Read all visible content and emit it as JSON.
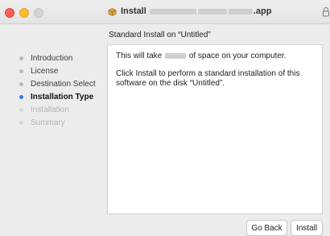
{
  "window": {
    "title_prefix": "Install",
    "title_suffix": ".app",
    "subtitle": "Standard Install on “Untitled”"
  },
  "sidebar": {
    "steps": [
      {
        "label": "Introduction",
        "state": "done"
      },
      {
        "label": "License",
        "state": "done"
      },
      {
        "label": "Destination Select",
        "state": "done"
      },
      {
        "label": "Installation Type",
        "state": "active"
      },
      {
        "label": "Installation",
        "state": "future"
      },
      {
        "label": "Summary",
        "state": "future"
      }
    ]
  },
  "content": {
    "line1_prefix": "This will take",
    "line1_suffix": "of space on your computer.",
    "line2": "Click Install to perform a standard installation of this software on the disk “Untitled”."
  },
  "buttons": {
    "back_label": "Go Back",
    "install_label": "Install"
  },
  "colors": {
    "close": "#ff5f57",
    "minimize": "#febc2e",
    "active_step": "#2d7cf6"
  },
  "icons": {
    "title_icon": "package-icon",
    "lock_icon": "lock-icon"
  }
}
